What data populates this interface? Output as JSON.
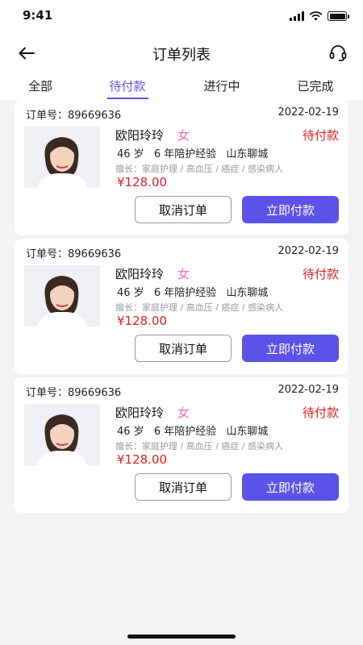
{
  "status_bar": {
    "time": "9:41",
    "battery_level": 1.0
  },
  "nav": {
    "title": "订单列表",
    "back_icon": "arrow-left-icon",
    "service_icon": "headset-icon"
  },
  "tabs": [
    {
      "label": "全部"
    },
    {
      "label": "待付款",
      "active": true
    },
    {
      "label": "进行中"
    },
    {
      "label": "已完成"
    }
  ],
  "order_no_label": "订单号：",
  "orders": [
    {
      "order_no": "89669636",
      "date": "2022-02-19",
      "name": "欧阳玲玲",
      "gender": "女",
      "status": "待付款",
      "age": "46 岁",
      "experience": "6 年陪护经验",
      "location": "山东聊城",
      "specialty": "擅长：家庭护理 / 高血压 / 癌症 / 感染病人",
      "price": "¥128.00",
      "cancel_label": "取消订单",
      "pay_label": "立即付款"
    },
    {
      "order_no": "89669636",
      "date": "2022-02-19",
      "name": "欧阳玲玲",
      "gender": "女",
      "status": "待付款",
      "age": "46 岁",
      "experience": "6 年陪护经验",
      "location": "山东聊城",
      "specialty": "擅长：家庭护理 / 高血压 / 癌症 / 感染病人",
      "price": "¥128.00",
      "cancel_label": "取消订单",
      "pay_label": "立即付款"
    },
    {
      "order_no": "89669636",
      "date": "2022-02-19",
      "name": "欧阳玲玲",
      "gender": "女",
      "status": "待付款",
      "age": "46 岁",
      "experience": "6 年陪护经验",
      "location": "山东聊城",
      "specialty": "擅长：家庭护理 / 高血压 / 癌症 / 感染病人",
      "price": "¥128.00",
      "cancel_label": "取消订单",
      "pay_label": "立即付款"
    }
  ],
  "colors": {
    "accent": "#5b53e8",
    "price": "#e02020",
    "gender": "#f06bb5",
    "background": "#f3f3f5"
  }
}
